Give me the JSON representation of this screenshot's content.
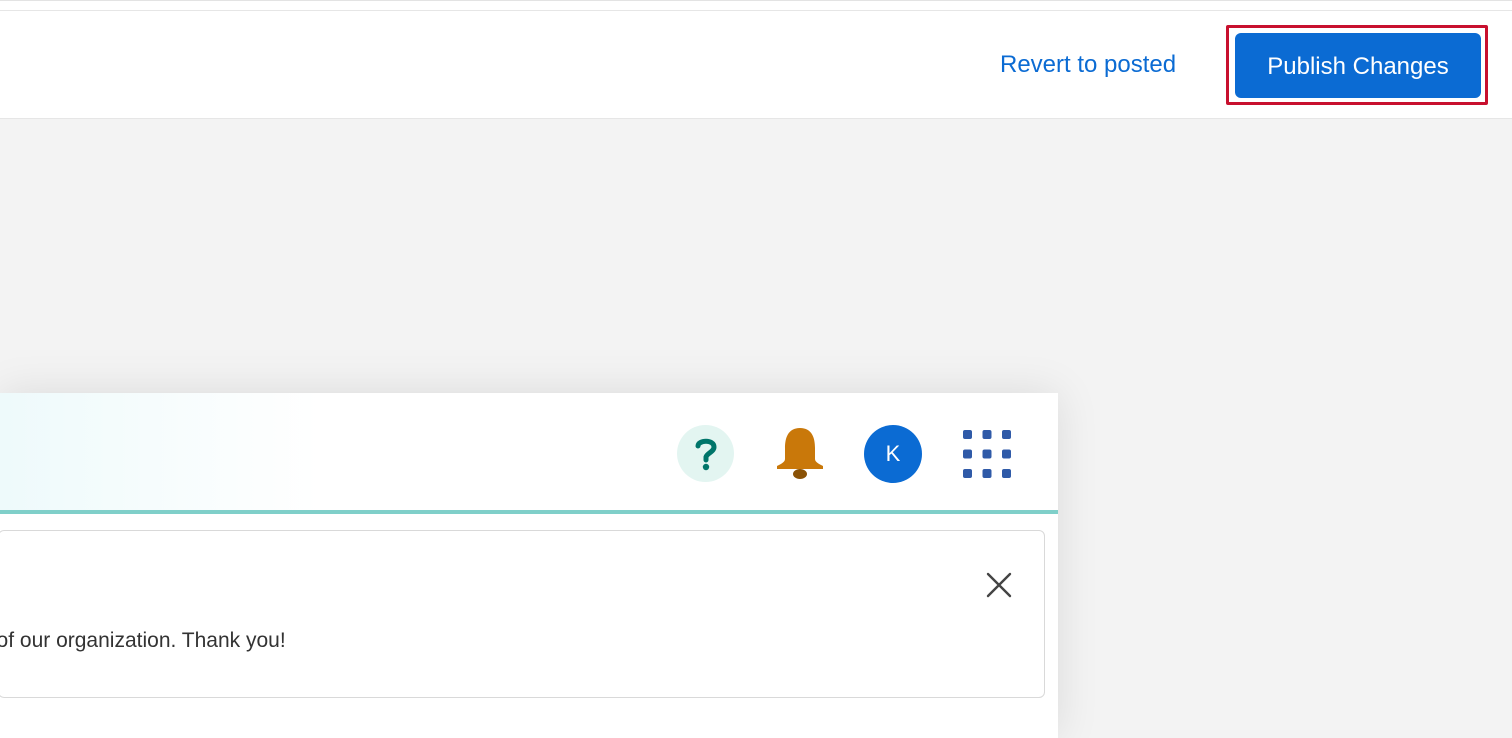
{
  "toolbar": {
    "revert_label": "Revert to posted",
    "publish_label": "Publish Changes",
    "accent_color": "#0b6bd3",
    "highlight_color": "#c8102e"
  },
  "preview": {
    "header": {
      "icons": [
        "question-mark-icon",
        "bell-icon",
        "avatar",
        "apps-grid-icon"
      ],
      "avatar_initial": "K",
      "help_icon_color": "#00756a",
      "bell_icon_color": "#c9780a",
      "apps_icon_color": "#2f5aa8",
      "accent_line_color": "#7fcfc9"
    },
    "notice": {
      "text": "outside of our organization. Thank you!",
      "close_icon": "close-icon"
    }
  }
}
